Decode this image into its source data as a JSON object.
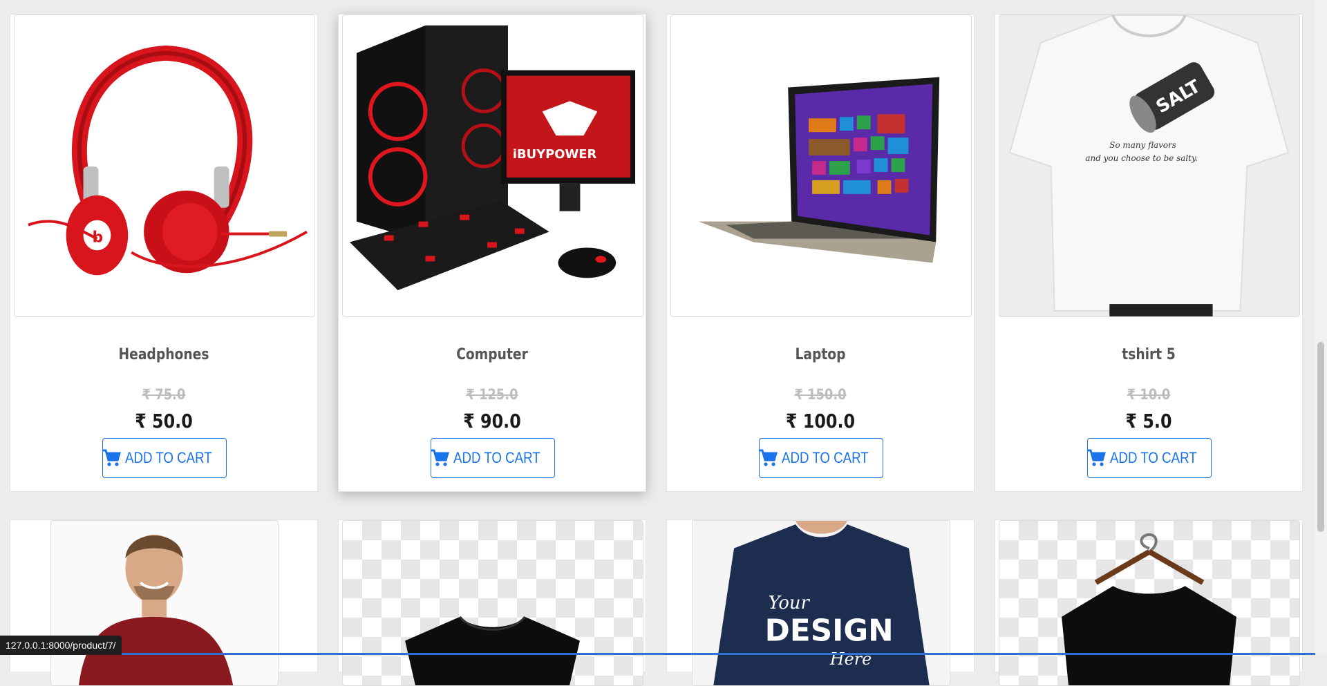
{
  "currency_symbol": "₹",
  "products": [
    {
      "name": "Headphones",
      "old_price": "₹ 75.0",
      "price": "₹ 50.0",
      "button": "ADD TO CART",
      "image": "red-headphones-image"
    },
    {
      "name": "Computer",
      "old_price": "₹ 125.0",
      "price": "₹ 90.0",
      "button": "ADD TO CART",
      "image": "gaming-computer-image"
    },
    {
      "name": "Laptop",
      "old_price": "₹ 150.0",
      "price": "₹ 100.0",
      "button": "ADD TO CART",
      "image": "laptop-image"
    },
    {
      "name": "tshirt 5",
      "old_price": "₹ 10.0",
      "price": "₹ 5.0",
      "button": "ADD TO CART",
      "image": "white-tshirt-image"
    }
  ],
  "row2_images": [
    "man-maroon-tshirt-image",
    "black-tshirt-image",
    "navy-design-tshirt-image",
    "hanger-black-tshirt-image"
  ],
  "design_shirt_text": {
    "line1": "Your",
    "line2": "DESIGN",
    "line3": "Here"
  },
  "tshirt_print": {
    "can": "SALT",
    "line1": "So many flavors",
    "line2": "and you choose to be salty."
  },
  "monitor_brand": "iBUYPOWER",
  "status_url": "127.0.0.1:8000/product/7/",
  "colors": {
    "accent": "#1a73e8",
    "old_price": "#bdbdbd",
    "price": "#1a1a1a",
    "name": "#555555"
  },
  "icons": {
    "cart": "cart-icon"
  }
}
